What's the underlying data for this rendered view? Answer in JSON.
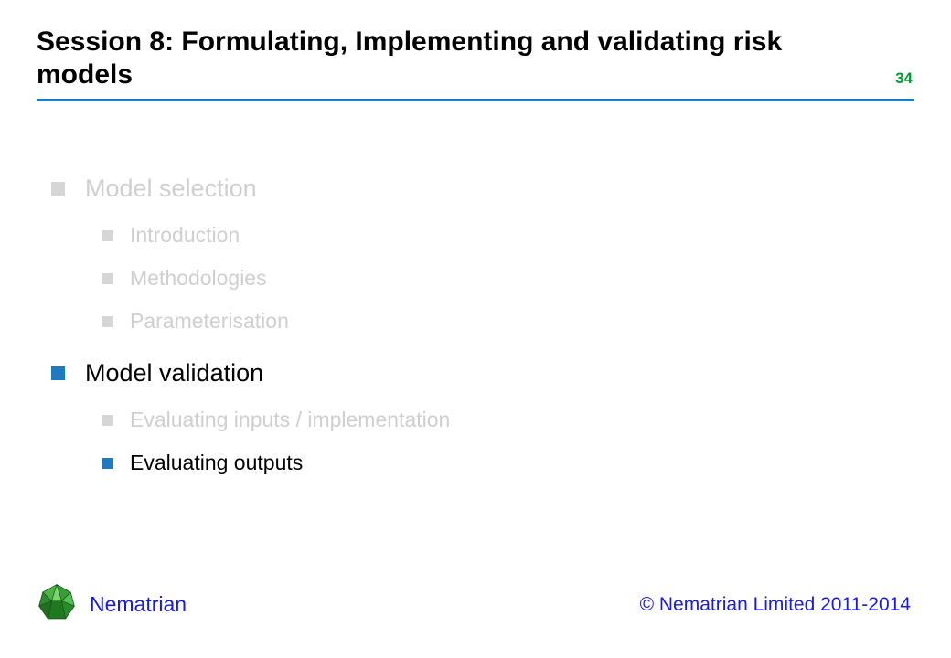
{
  "slide": {
    "title": "Session 8: Formulating, Implementing and validating risk models",
    "page_number": "34"
  },
  "outline": {
    "sections": [
      {
        "label": "Model selection",
        "active": false,
        "items": [
          {
            "label": "Introduction",
            "active": false
          },
          {
            "label": "Methodologies",
            "active": false
          },
          {
            "label": "Parameterisation",
            "active": false
          }
        ]
      },
      {
        "label": "Model validation",
        "active": true,
        "items": [
          {
            "label": "Evaluating inputs / implementation",
            "active": false
          },
          {
            "label": "Evaluating outputs",
            "active": true
          }
        ]
      }
    ]
  },
  "footer": {
    "brand": "Nematrian",
    "copyright": "© Nematrian Limited 2011-2014"
  }
}
